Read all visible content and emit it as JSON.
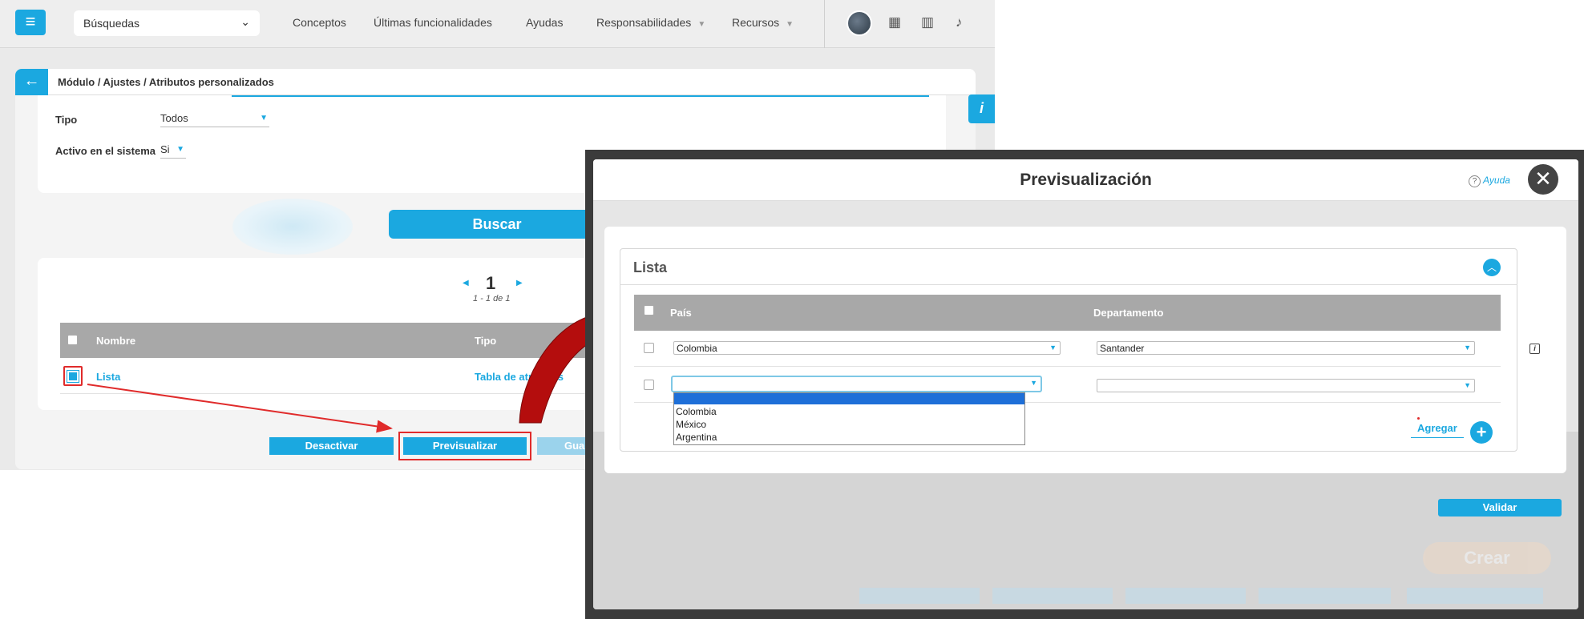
{
  "topbar": {
    "search_select_value": "Búsquedas",
    "nav": [
      "Conceptos",
      "Últimas funcionalidades",
      "Ayudas",
      "Responsabilidades",
      "Recursos"
    ],
    "icons": [
      "calendar-icon",
      "book-icon",
      "bell-icon"
    ]
  },
  "page": {
    "breadcrumb": "Módulo / Ajustes / Atributos personalizados",
    "info_tab": "i",
    "filters": {
      "tipo_label": "Tipo",
      "tipo_value": "Todos",
      "activo_label": "Activo en el sistema",
      "activo_value": "Si"
    },
    "search_button": "Buscar",
    "pager": {
      "current": "1",
      "range": "1 - 1 de 1"
    },
    "results": {
      "columns": [
        "Nombre",
        "Tipo"
      ],
      "rows": [
        {
          "nombre": "Lista",
          "tipo": "Tabla de atributos"
        }
      ]
    },
    "actions": {
      "desactivar": "Desactivar",
      "previsualizar": "Previsualizar",
      "guardar": "Gua"
    }
  },
  "modal": {
    "title": "Previsualización",
    "help": "Ayuda",
    "section_title": "Lista",
    "columns": [
      "País",
      "Departamento"
    ],
    "rows": [
      {
        "pais": "Colombia",
        "departamento": "Santander"
      },
      {
        "pais": "",
        "departamento": ""
      }
    ],
    "dropdown_options": [
      "Colombia",
      "México",
      "Argentina"
    ],
    "add_label": "Agregar",
    "validate_label": "Validar",
    "ghost": {
      "crear": "Crear"
    }
  },
  "colors": {
    "accent": "#1ba8e0",
    "highlight_red": "#e02b2b",
    "header_gray": "#a8a8a8"
  }
}
